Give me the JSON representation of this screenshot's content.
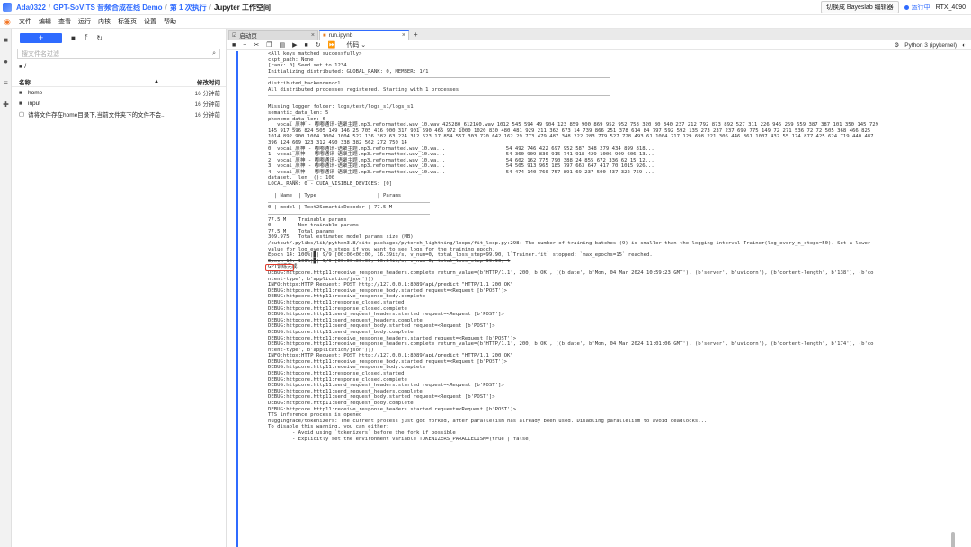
{
  "header": {
    "crumbs": [
      "Ada0322",
      "GPT-SoVITS 音频合成在线 Demo",
      "第 1 次执行",
      "Jupyter 工作空间"
    ],
    "switch_label": "切换成 Bayeslab 编辑器",
    "status": "运行中",
    "gpu": "RTX_4090"
  },
  "menu": [
    "文件",
    "编辑",
    "查看",
    "运行",
    "内核",
    "标签页",
    "设置",
    "帮助"
  ],
  "filepanel": {
    "new_label": "+",
    "filter_placeholder": "搜文件名过滤",
    "path": "/",
    "col_name": "名称",
    "col_modified": "修改时间",
    "files": [
      {
        "icon": "folder",
        "name": "home",
        "modified": "16 分钟前"
      },
      {
        "icon": "folder",
        "name": "input",
        "modified": "16 分钟前"
      },
      {
        "icon": "file",
        "name": "请将文件存在home目录下,当前文件夹下的文件不会...",
        "modified": "16 分钟前"
      }
    ]
  },
  "tabs": [
    {
      "label": "启动页",
      "active": false
    },
    {
      "label": "run.ipynb",
      "active": true
    }
  ],
  "notebook": {
    "cell_type": "代码",
    "kernel": "Python 3 (ipykernel)"
  },
  "output_lines": [
    "<All keys matched successfully>",
    "ckpt_path: None",
    "[rank: 0] Seed set to 1234",
    "Initializing distributed: GLOBAL_RANK: 0, MEMBER: 1/1",
    "---HR---",
    "distributed_backend=nccl",
    "All distributed processes registered. Starting with 1 processes",
    "---HR---",
    "",
    "Missing logger folder: logs/test/logs_s1/logs_s1",
    "semantic_data_len: 5",
    "phoneme_data_len: 6",
    "   vocal_原神 - 嘟嘟通讯-语聚主题.mp3.reformatted.wav_10.wav_425280_612160.wav 1012 545 594 49 904 123 859 900 869 952 952 758 320 80 340 237 212 792 873 892 527 311 226 945 259 659 387 387 101 350 145 729",
    "145 917 596 824 505 149 146 25 705 416 900 317 901 690 465 972 1000 1020 830 480 481 929 211 362 673 14 739 866 251 378 614 84 797 592 592 135 273 237 237 699 775 149 72 271 536 72 72 505 368 466 825",
    "1014 892 900 1004 1004 1004 527 136 382 63 224 312 623 17 854 557 303 720 642 162 29 773 479 487 348 222 283 779 527 728 493 61 1004 217 129 698 221 306 446 361 1007 432 55 174 877 425 624 719 440 487",
    "396 124 669 123 312 490 338 382 562 272 750 14",
    "0  vocal_原神 - 嘟嘟通讯-语聚主题.mp3.reformatted.wav_10.wa...                    54 492 746 422 697 952 587 348 279 434 899 818...",
    "1  vocal_原神 - 嘟嘟通讯-语聚主题.mp3.reformatted.wav_10.wa...                    54 360 909 830 915 741 918 429 1006 909 606 13...",
    "2  vocal_原神 - 嘟嘟通讯-语聚主题.mp3.reformatted.wav_10.wa...                    54 602 162 775 790 388 24 855 672 336 62 15 12...",
    "3  vocal_原神 - 嘟嘟通讯-语聚主题.mp3.reformatted.wav_10.wa...                    54 505 913 965 185 797 663 647 417 70 1015 926...",
    "4  vocal_原神 - 嘟嘟通讯-语聚主题.mp3.reformatted.wav_10.wa...                    54 474 140 760 757 891 69 237 500 437 322 759 ...",
    "dataset.__len__(): 100",
    "LOCAL_RANK: 0 - CUDA_VISIBLE_DEVICES: [0]",
    "",
    "  | Name  | Type                    | Params",
    "---HR2---",
    "0 | model | Text2SemanticDecoder | 77.5 M",
    "---HR2---",
    "77.5 M    Trainable params",
    "0         Non-trainable params",
    "77.5 M    Total params",
    "309.975   Total estimated model params size (MB)",
    "/output/.pylibs/lib/python3.8/site-packages/pytorch_lightning/loops/fit_loop.py:298: The number of training batches (9) is smaller than the logging interval Trainer(log_every_n_steps=50). Set a lower",
    "value for log_every_n_steps if you want to see logs for the training epoch.",
    "Epoch 14: 100%|█| 9/9 [00:00<00:00, 16.39it/s, v_num=0, total_loss_step=99.90, l`Trainer.fit` stopped: `max_epochs=15` reached.",
    "Epoch 14: 100%|█| 9/9 [00:00<00:00, 16.34it/s, v_num=0, total_loss_step=99.90, l",
    "GPT训练完成",
    "DEBUG:httpcore.http11:receive_response_headers.complete return_value=(b'HTTP/1.1', 200, b'OK', [(b'date', b'Mon, 04 Mar 2024 10:59:23 GMT'), (b'server', b'uvicorn'), (b'content-length', b'138'), (b'co",
    "ntent-type', b'application/json')])",
    "INFO:httpx:HTTP Request: POST http://127.0.0.1:8089/api/predict \"HTTP/1.1 200 OK\"",
    "DEBUG:httpcore.http11:receive_response_body.started request=<Request [b'POST']>",
    "DEBUG:httpcore.http11:receive_response_body.complete",
    "DEBUG:httpcore.http11:response_closed.started",
    "DEBUG:httpcore.http11:response_closed.complete",
    "DEBUG:httpcore.http11:send_request_headers.started request=<Request [b'POST']>",
    "DEBUG:httpcore.http11:send_request_headers.complete",
    "DEBUG:httpcore.http11:send_request_body.started request=<Request [b'POST']>",
    "DEBUG:httpcore.http11:send_request_body.complete",
    "DEBUG:httpcore.http11:receive_response_headers.started request=<Request [b'POST']>",
    "DEBUG:httpcore.http11:receive_response_headers.complete return_value=(b'HTTP/1.1', 200, b'OK', [(b'date', b'Mon, 04 Mar 2024 11:01:06 GMT'), (b'server', b'uvicorn'), (b'content-length', b'174'), (b'co",
    "ntent-type', b'application/json')])",
    "INFO:httpx:HTTP Request: POST http://127.0.0.1:8089/api/predict \"HTTP/1.1 200 OK\"",
    "DEBUG:httpcore.http11:receive_response_body.started request=<Request [b'POST']>",
    "DEBUG:httpcore.http11:receive_response_body.complete",
    "DEBUG:httpcore.http11:response_closed.started",
    "DEBUG:httpcore.http11:response_closed.complete",
    "DEBUG:httpcore.http11:send_request_headers.started request=<Request [b'POST']>",
    "DEBUG:httpcore.http11:send_request_headers.complete",
    "DEBUG:httpcore.http11:send_request_body.started request=<Request [b'POST']>",
    "DEBUG:httpcore.http11:send_request_body.complete",
    "DEBUG:httpcore.http11:receive_response_headers.started request=<Request [b'POST']>",
    "TTS inference process is opened",
    "huggingface/tokenizers: The current process just got forked, after parallelism has already been used. Disabling parallelism to avoid deadlocks...",
    "To disable this warning, you can either:",
    "        - Avoid using `tokenizers` before the fork if possible",
    "        - Explicitly set the environment variable TOKENIZERS_PARALLELISM=(true | false)"
  ],
  "highlight_text": "GPT训练完成"
}
